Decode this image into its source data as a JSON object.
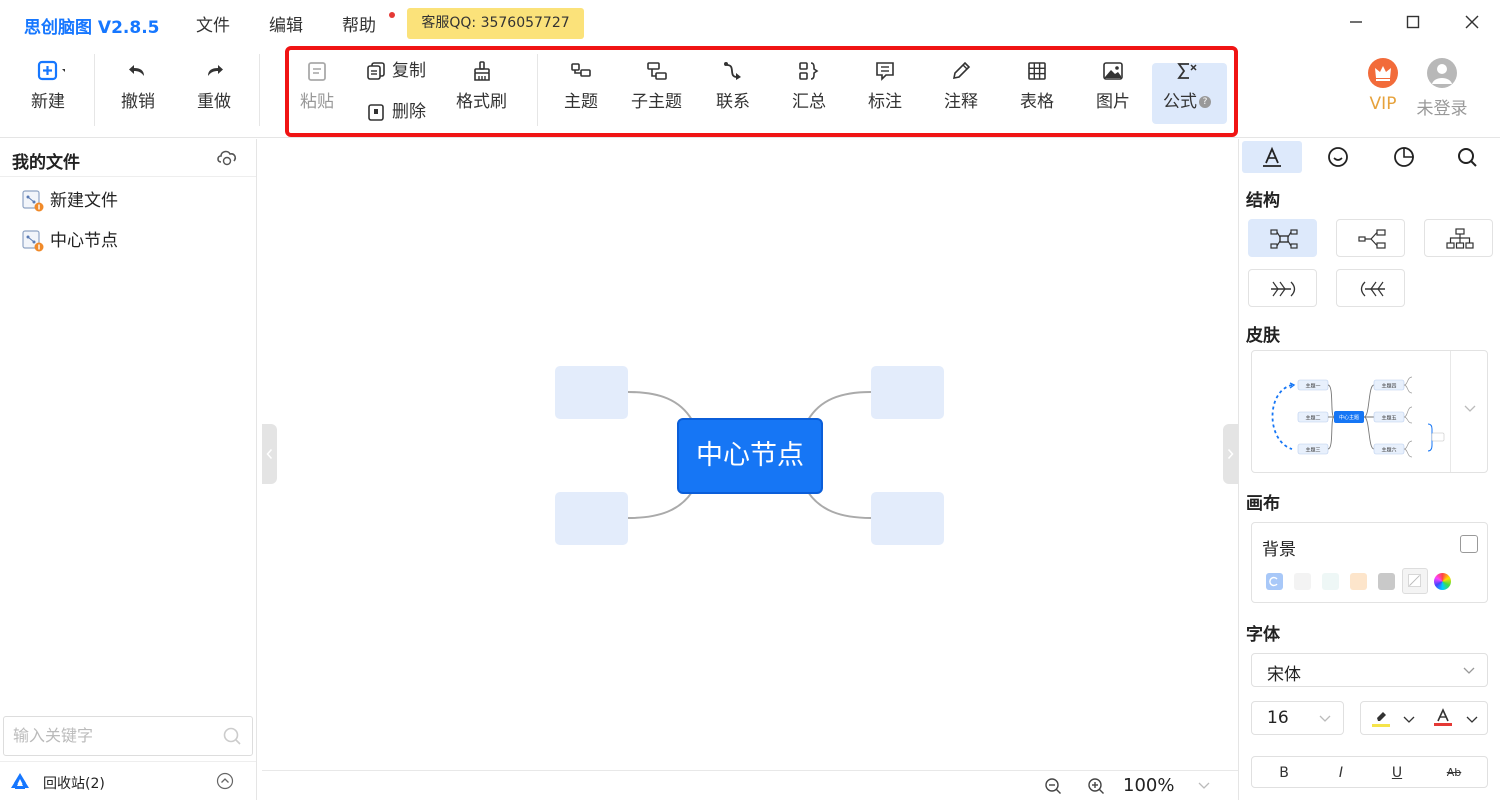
{
  "app": {
    "title": "思创脑图 V2.8.5"
  },
  "menu": {
    "file": "文件",
    "edit": "编辑",
    "help": "帮助",
    "qq_badge": "客服QQ: 3576057727"
  },
  "toolbar": {
    "new": "新建",
    "undo": "撤销",
    "redo": "重做",
    "paste": "粘贴",
    "copy": "复制",
    "delete": "删除",
    "format_brush": "格式刷",
    "topic": "主题",
    "subtopic": "子主题",
    "relation": "联系",
    "summary": "汇总",
    "callout": "标注",
    "note": "注释",
    "table": "表格",
    "image": "图片",
    "formula": "公式"
  },
  "account": {
    "vip": "VIP",
    "login": "未登录"
  },
  "sidebar": {
    "title": "我的文件",
    "files": [
      {
        "label": "新建文件"
      },
      {
        "label": "中心节点"
      }
    ],
    "search_placeholder": "输入关键字",
    "trash": "回收站(2)"
  },
  "canvas": {
    "center_node": "中心节点",
    "zoom": "100%"
  },
  "panel": {
    "structure": "结构",
    "skin": "皮肤",
    "canvas": "画布",
    "background": "背景",
    "font": "字体",
    "font_family": "宋体",
    "font_size": "16",
    "bold": "B",
    "italic": "I",
    "underline": "U",
    "strike": "Ab"
  },
  "skin_preview": {
    "center": "中心主题",
    "left": [
      "主题一",
      "主题二",
      "主题三"
    ],
    "right": [
      "主题四",
      "主题五",
      "主题六"
    ]
  },
  "colors": {
    "accent": "#1677ff",
    "node": "#1676f5",
    "branch": "#e3ecfb",
    "highlight": "#f01414",
    "qq_badge": "#fbe27a",
    "swatches": [
      "#a8c8f8",
      "#f3f3f3",
      "#eef7f6",
      "#fde5cb",
      "#c9c9c9",
      "#ffffff",
      "rainbow"
    ]
  }
}
